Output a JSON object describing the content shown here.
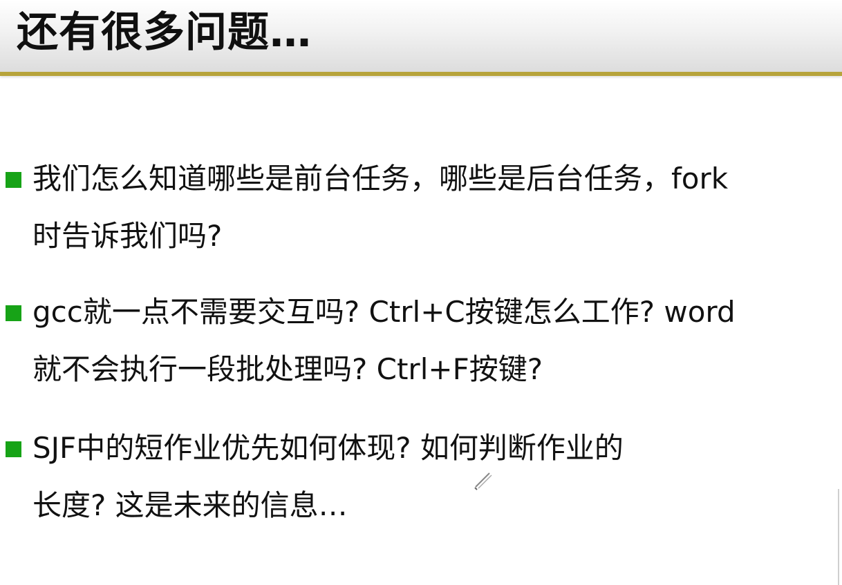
{
  "slide": {
    "title": "还有很多问题…",
    "accent_color": "#b7a43b",
    "bullet_color": "#17a317"
  },
  "bullets": [
    {
      "line1": "我们怎么知道哪些是前台任务，哪些是后台任务，fork",
      "line2": "时告诉我们吗?"
    },
    {
      "line1": "gcc就一点不需要交互吗? Ctrl+C按键怎么工作? word",
      "line2": "就不会执行一段批处理吗? Ctrl+F按键?"
    },
    {
      "line1": "SJF中的短作业优先如何体现? 如何判断作业的",
      "line2": "长度? 这是未来的信息…"
    }
  ],
  "icons": {
    "bullet": "square-bullet-icon",
    "cursor": "pen-cursor-icon"
  }
}
